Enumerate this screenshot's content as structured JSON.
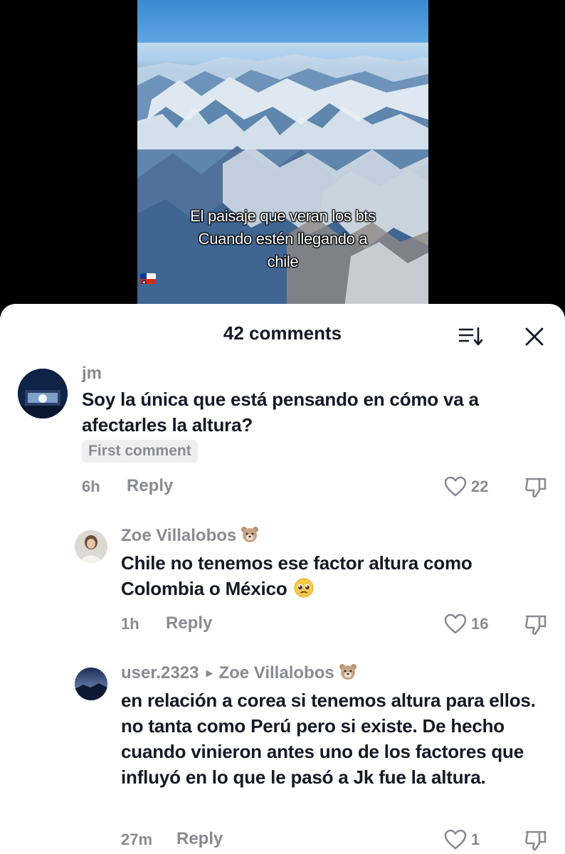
{
  "video": {
    "caption_lines": [
      "El paisaje que veran los bts",
      "Cuando  estén llegando a",
      "chile"
    ],
    "flag_emoji": "chile-flag"
  },
  "comments_panel": {
    "title": "42 comments",
    "sort_icon": "sort-icon",
    "close_icon": "close-icon"
  },
  "comments": [
    {
      "username": "jm",
      "text": "Soy la única que está pensando en cómo va a afectarles la altura?",
      "badge": "First comment",
      "time": "6h",
      "reply_label": "Reply",
      "likes": "22"
    },
    {
      "username": "Zoe Villalobos",
      "username_emoji": "bear-face",
      "text": "Chile no tenemos ese factor altura como Colombia o México",
      "text_emoji": "pleading-face",
      "time": "1h",
      "reply_label": "Reply",
      "likes": "16"
    },
    {
      "username": "user.2323",
      "reply_to": "Zoe Villalobos",
      "reply_to_emoji": "bear-face",
      "text": "en relación a corea si tenemos altura para ellos. no tanta como Perú pero si existe. De hecho cuando vinieron antes uno de los factores que influyó en lo que le pasó a Jk fue la altura.",
      "time": "27m",
      "reply_label": "Reply",
      "likes": "1"
    }
  ],
  "colors": {
    "text_primary": "#161823",
    "text_secondary": "#8a8b91",
    "badge_bg": "#efefef",
    "background_dark": "#000000"
  }
}
